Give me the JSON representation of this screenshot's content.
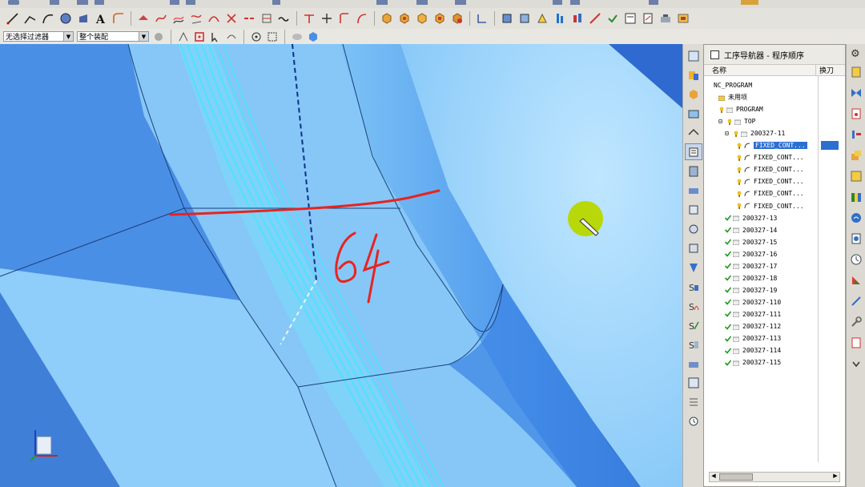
{
  "toolbar": {
    "filter_dropdown": "无选择过滤器",
    "assembly_dropdown": "整个装配"
  },
  "navigator": {
    "title": "工序导航器 - 程序顺序",
    "col_name": "名称",
    "col_tool_change": "换刀",
    "tree": [
      {
        "label": "NC_PROGRAM",
        "depth": 0,
        "icon": "none"
      },
      {
        "label": "未用项",
        "depth": 1,
        "icon": "folder-icon"
      },
      {
        "label": "PROGRAM",
        "depth": 1,
        "icon": "program-icon"
      },
      {
        "label": "TOP",
        "depth": 1,
        "icon": "program-icon",
        "expanded": true
      },
      {
        "label": "200327-11",
        "depth": 2,
        "icon": "program-icon",
        "expanded": true
      },
      {
        "label": "FIXED_CONT...",
        "depth": 3,
        "icon": "operation-icon",
        "selected": true
      },
      {
        "label": "FIXED_CONT...",
        "depth": 3,
        "icon": "operation-icon"
      },
      {
        "label": "FIXED_CONT...",
        "depth": 3,
        "icon": "operation-icon"
      },
      {
        "label": "FIXED_CONT...",
        "depth": 3,
        "icon": "operation-icon"
      },
      {
        "label": "FIXED_CONT...",
        "depth": 3,
        "icon": "operation-icon"
      },
      {
        "label": "FIXED_CONT...",
        "depth": 3,
        "icon": "operation-icon"
      },
      {
        "label": "200327-13",
        "depth": 2,
        "icon": "checkmark-icon"
      },
      {
        "label": "200327-14",
        "depth": 2,
        "icon": "checkmark-icon"
      },
      {
        "label": "200327-15",
        "depth": 2,
        "icon": "checkmark-icon"
      },
      {
        "label": "200327-16",
        "depth": 2,
        "icon": "checkmark-icon"
      },
      {
        "label": "200327-17",
        "depth": 2,
        "icon": "checkmark-icon"
      },
      {
        "label": "200327-18",
        "depth": 2,
        "icon": "checkmark-icon"
      },
      {
        "label": "200327-19",
        "depth": 2,
        "icon": "checkmark-icon"
      },
      {
        "label": "200327-110",
        "depth": 2,
        "icon": "checkmark-icon"
      },
      {
        "label": "200327-111",
        "depth": 2,
        "icon": "checkmark-icon"
      },
      {
        "label": "200327-112",
        "depth": 2,
        "icon": "checkmark-icon"
      },
      {
        "label": "200327-113",
        "depth": 2,
        "icon": "checkmark-icon"
      },
      {
        "label": "200327-114",
        "depth": 2,
        "icon": "checkmark-icon"
      },
      {
        "label": "200327-115",
        "depth": 2,
        "icon": "checkmark-icon"
      }
    ]
  },
  "viewport": {
    "annotation_text": "64",
    "colors": {
      "background": "#4a8fe6",
      "surface_light": "#8cccfa",
      "surface_mid": "#5aa9f2",
      "toolpath": "#3fe0ff",
      "annotation": "#e8231f",
      "cursor_highlight": "#b8d80a"
    }
  }
}
